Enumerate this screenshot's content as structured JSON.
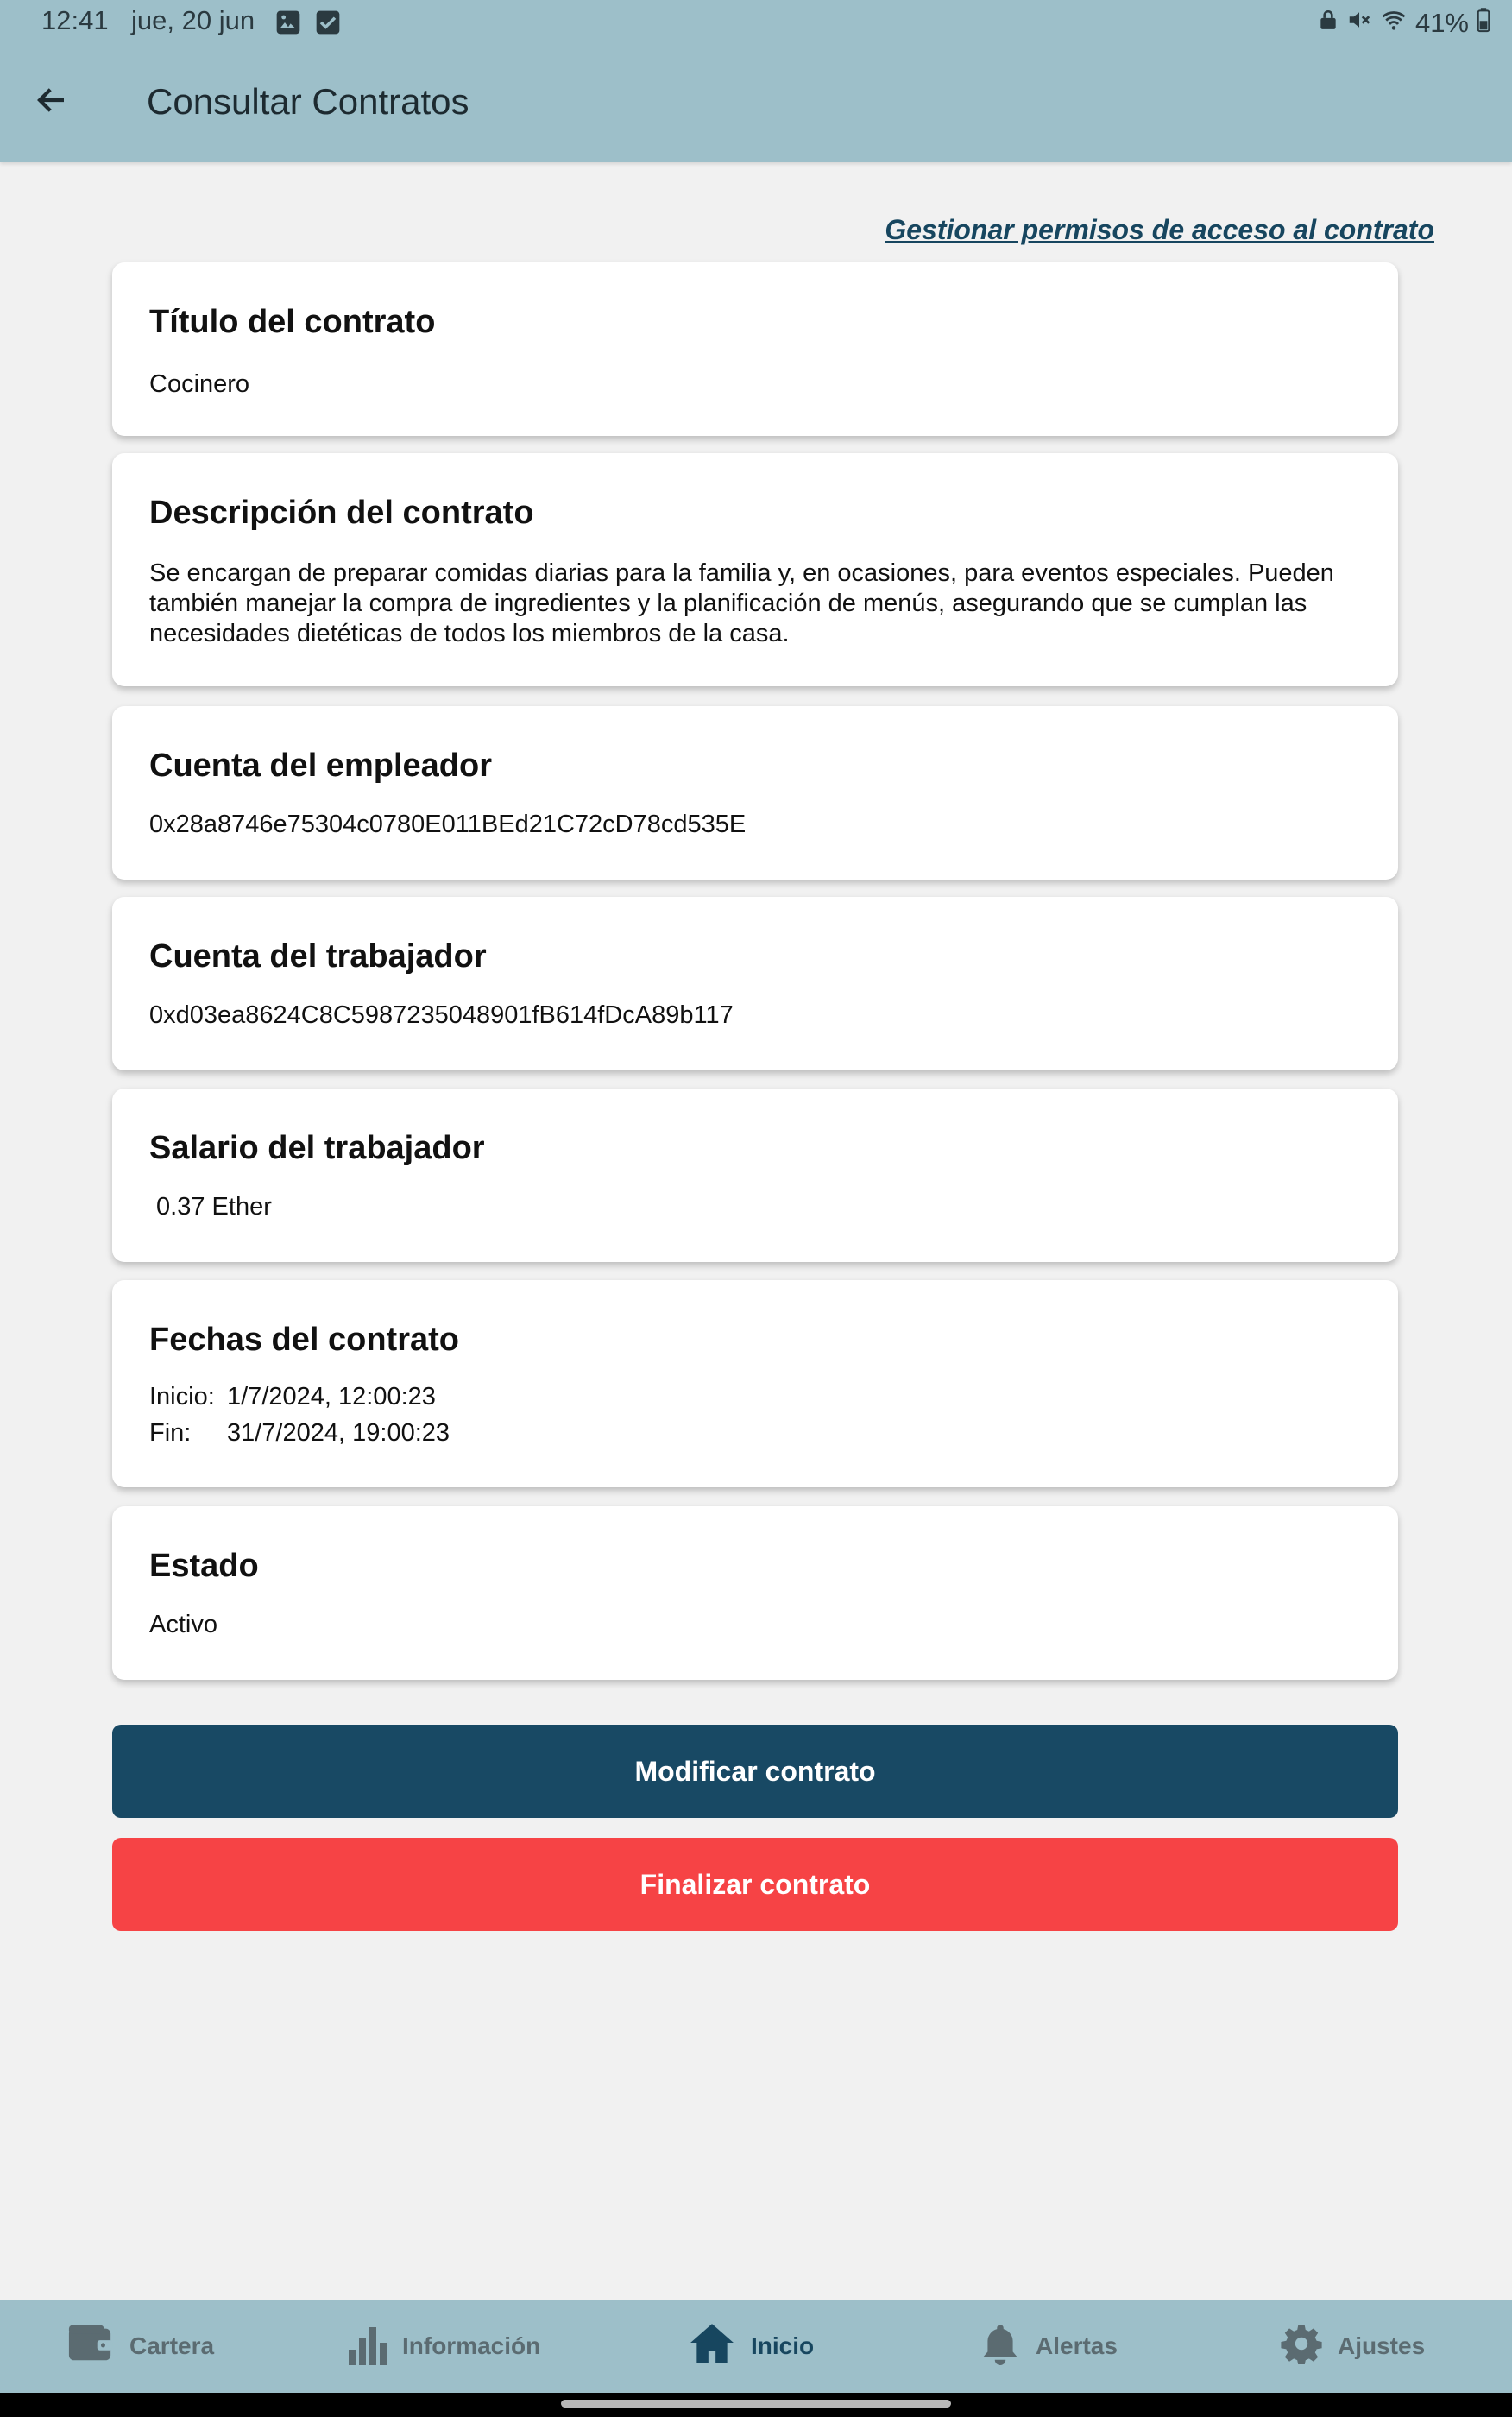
{
  "status_bar": {
    "time": "12:41",
    "date": "jue, 20 jun",
    "battery": "41%"
  },
  "header": {
    "title": "Consultar Contratos"
  },
  "manage_link": "Gestionar permisos de acceso al contrato",
  "cards": {
    "title": {
      "label": "Título del contrato",
      "value": "Cocinero"
    },
    "description": {
      "label": "Descripción del contrato",
      "value": " Se encargan de preparar comidas diarias para la familia y, en ocasiones, para eventos especiales. Pueden también manejar la compra de ingredientes y la planificación de menús, asegurando que se cumplan las necesidades dietéticas de todos los miembros de la casa."
    },
    "employer": {
      "label": "Cuenta del empleador",
      "value": "0x28a8746e75304c0780E011BEd21C72cD78cd535E"
    },
    "worker": {
      "label": "Cuenta del trabajador",
      "value": "0xd03ea8624C8C5987235048901fB614fDcA89b117"
    },
    "salary": {
      "label": "Salario del trabajador",
      "value": " 0.37 Ether"
    },
    "dates": {
      "label": "Fechas del contrato",
      "start_label": "Inicio:",
      "start_value": "1/7/2024, 12:00:23",
      "end_label": "Fin:",
      "end_value": "31/7/2024, 19:00:23"
    },
    "status": {
      "label": "Estado",
      "value": "Activo"
    }
  },
  "buttons": {
    "modify": "Modificar contrato",
    "finish": "Finalizar contrato"
  },
  "bottom_nav": {
    "items": [
      {
        "label": "Cartera",
        "icon": "wallet-icon"
      },
      {
        "label": "Información",
        "icon": "bar-chart-icon"
      },
      {
        "label": "Inicio",
        "icon": "home-icon",
        "active": true
      },
      {
        "label": "Alertas",
        "icon": "bell-icon"
      },
      {
        "label": "Ajustes",
        "icon": "gear-icon"
      }
    ]
  },
  "colors": {
    "appbar": "#9dbfc9",
    "primary": "#184964",
    "danger": "#f64345",
    "link": "#17465f"
  }
}
